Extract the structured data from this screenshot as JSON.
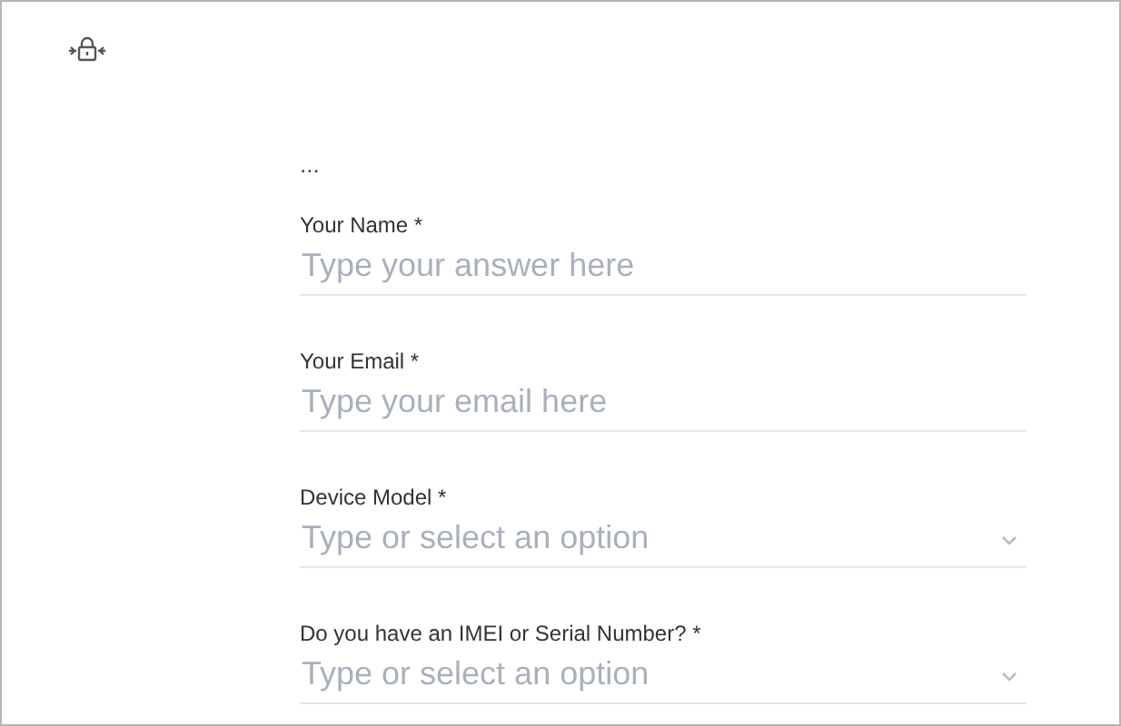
{
  "intro": "...",
  "fields": [
    {
      "kind": "text",
      "label": "Your Name *",
      "placeholder": "Type your answer here"
    },
    {
      "kind": "text",
      "label": "Your Email *",
      "placeholder": "Type your email here"
    },
    {
      "kind": "select",
      "label": "Device Model *",
      "placeholder": "Type or select an option"
    },
    {
      "kind": "select",
      "label": "Do you have an IMEI or Serial Number? *",
      "placeholder": "Type or select an option"
    }
  ]
}
